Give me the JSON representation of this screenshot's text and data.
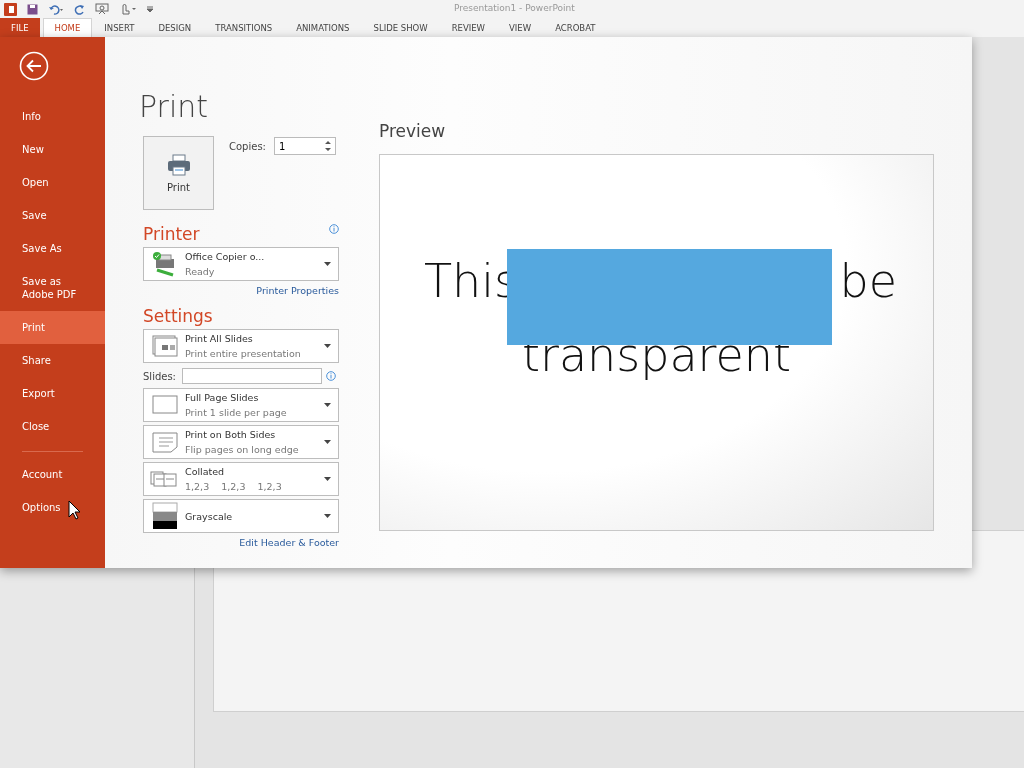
{
  "window": {
    "title": "Presentation1 - PowerPoint"
  },
  "ribbon_tabs": [
    {
      "label": "FILE",
      "kind": "file",
      "selected": false
    },
    {
      "label": "HOME",
      "kind": "tab",
      "selected": true
    },
    {
      "label": "INSERT",
      "kind": "tab",
      "selected": false
    },
    {
      "label": "DESIGN",
      "kind": "tab",
      "selected": false
    },
    {
      "label": "TRANSITIONS",
      "kind": "tab",
      "selected": false
    },
    {
      "label": "ANIMATIONS",
      "kind": "tab",
      "selected": false
    },
    {
      "label": "SLIDE SHOW",
      "kind": "tab",
      "selected": false
    },
    {
      "label": "REVIEW",
      "kind": "tab",
      "selected": false
    },
    {
      "label": "VIEW",
      "kind": "tab",
      "selected": false
    },
    {
      "label": "ACROBAT",
      "kind": "tab",
      "selected": false
    }
  ],
  "backstage": {
    "nav": [
      {
        "label": "Info",
        "selected": false
      },
      {
        "label": "New",
        "selected": false
      },
      {
        "label": "Open",
        "selected": false
      },
      {
        "label": "Save",
        "selected": false
      },
      {
        "label": "Save As",
        "selected": false
      },
      {
        "label": "Save as Adobe PDF",
        "selected": false
      },
      {
        "label": "Print",
        "selected": true
      },
      {
        "label": "Share",
        "selected": false
      },
      {
        "label": "Export",
        "selected": false
      },
      {
        "label": "Close",
        "selected": false
      }
    ],
    "nav_bottom": [
      {
        "label": "Account",
        "selected": false
      },
      {
        "label": "Options",
        "selected": false
      }
    ]
  },
  "print": {
    "title": "Print",
    "button": "Print",
    "copies_label": "Copies:",
    "copies_value": "1",
    "printer_heading": "Printer",
    "printer": {
      "name": "Office Copier o...",
      "status": "Ready"
    },
    "printer_properties": "Printer Properties",
    "settings_heading": "Settings",
    "settings": [
      {
        "kind": "slides",
        "title": "Print All Slides",
        "subtitle": "Print entire presentation"
      },
      {
        "kind": "field",
        "label": "Slides:"
      },
      {
        "kind": "layout",
        "title": "Full Page Slides",
        "subtitle": "Print 1 slide per page"
      },
      {
        "kind": "sides",
        "title": "Print on Both Sides",
        "subtitle": "Flip pages on long edge"
      },
      {
        "kind": "collation",
        "title": "Collated",
        "subtitle": "1,2,3    1,2,3    1,2,3"
      },
      {
        "kind": "color",
        "title": "Grayscale"
      }
    ],
    "edit_header_footer": "Edit Header & Footer"
  },
  "preview": {
    "label": "Preview",
    "slide": {
      "word_left": "This",
      "word_right": "be",
      "line_2": "transparent"
    }
  }
}
